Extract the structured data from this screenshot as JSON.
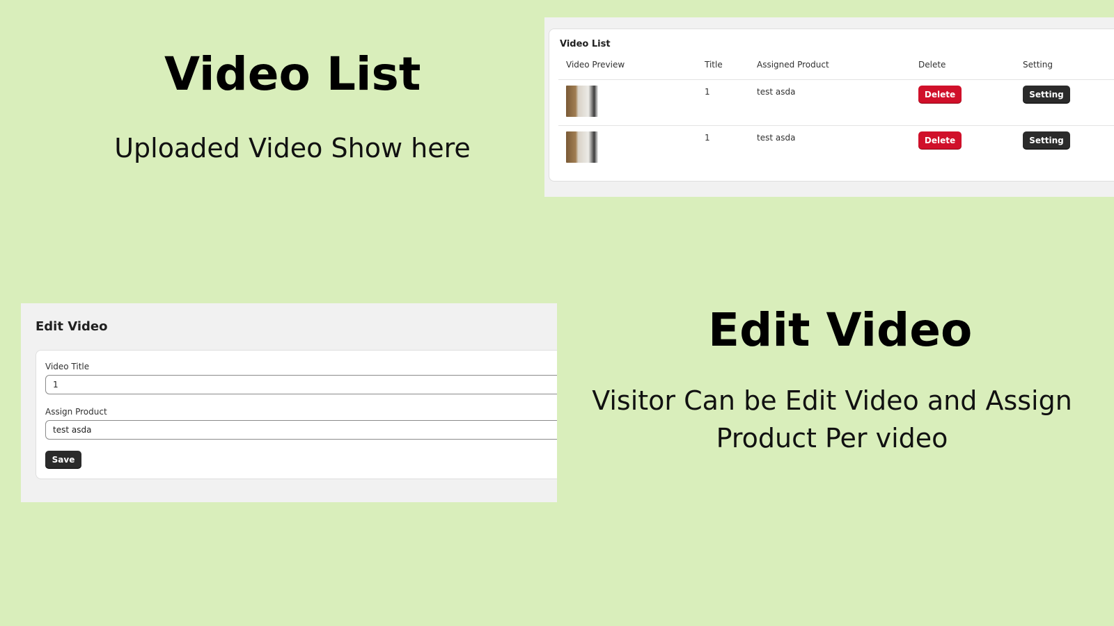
{
  "promo": {
    "video_list": {
      "heading": "Video List",
      "subtitle": "Uploaded Video Show here"
    },
    "edit_video": {
      "heading": "Edit Video",
      "subtitle": "Visitor Can be Edit Video and Assign Product Per video"
    }
  },
  "video_list_panel": {
    "title": "Video List",
    "columns": [
      "Video Preview",
      "Title",
      "Assigned Product",
      "Delete",
      "Setting"
    ],
    "rows": [
      {
        "title": "1",
        "assigned_product": "test asda",
        "delete_label": "Delete",
        "setting_label": "Setting",
        "thumbnail": "video-thumbnail"
      },
      {
        "title": "1",
        "assigned_product": "test asda",
        "delete_label": "Delete",
        "setting_label": "Setting",
        "thumbnail": "video-thumbnail"
      }
    ]
  },
  "edit_video_panel": {
    "title": "Edit Video",
    "fields": [
      {
        "label": "Video Title",
        "value": "1"
      },
      {
        "label": "Assign Product",
        "value": "test asda"
      }
    ],
    "save_label": "Save"
  },
  "colors": {
    "background": "#d9eebb",
    "panel": "#f1f1f1",
    "delete_button": "#d0102a",
    "dark_button": "#2b2b2b"
  }
}
